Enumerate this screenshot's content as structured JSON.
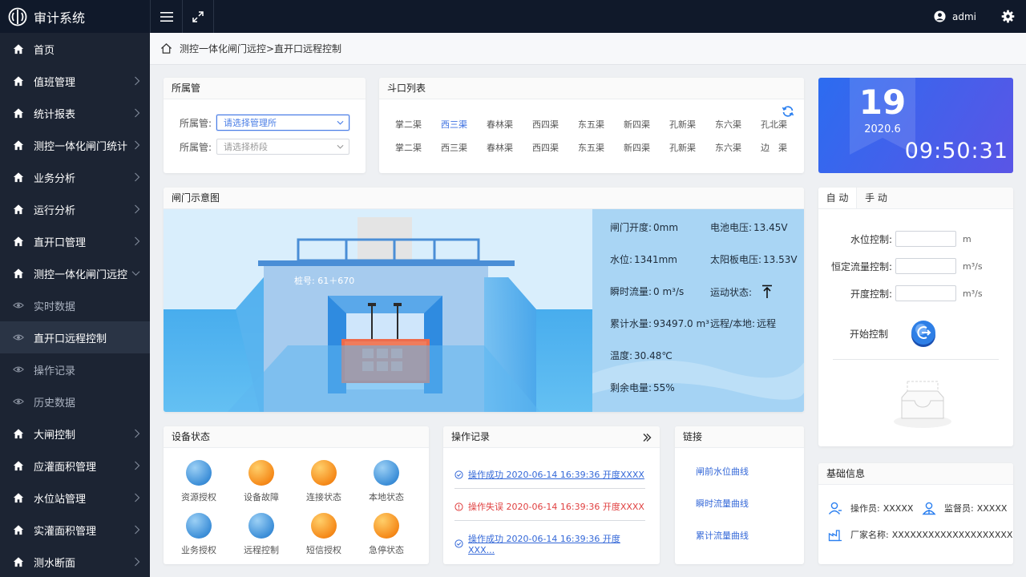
{
  "app": {
    "title": "审计系统",
    "user": "admi"
  },
  "sidebar": {
    "items": [
      {
        "label": "首页",
        "name": "home",
        "chevron": false
      },
      {
        "label": "值班管理",
        "name": "duty",
        "chevron": true
      },
      {
        "label": "统计报表",
        "name": "reports",
        "chevron": true
      },
      {
        "label": "测控一体化闸门统计",
        "name": "gate-stats",
        "chevron": true
      },
      {
        "label": "业务分析",
        "name": "business",
        "chevron": true
      },
      {
        "label": "运行分析",
        "name": "operation",
        "chevron": true
      },
      {
        "label": "直开口管理",
        "name": "outlet-mgmt",
        "chevron": true
      },
      {
        "label": "测控一体化闸门远控",
        "name": "gate-remote",
        "chevron": true,
        "open": true
      },
      {
        "label": "实时数据",
        "name": "realtime",
        "sub": true
      },
      {
        "label": "直开口远程控制",
        "name": "outlet-remote",
        "sub": true,
        "active": true
      },
      {
        "label": "操作记录",
        "name": "op-records",
        "sub": true
      },
      {
        "label": "历史数据",
        "name": "history",
        "sub": true
      },
      {
        "label": "大闸控制",
        "name": "big-gate",
        "chevron": true
      },
      {
        "label": "应灌面积管理",
        "name": "irrigation-area",
        "chevron": true
      },
      {
        "label": "水位站管理",
        "name": "water-station",
        "chevron": true
      },
      {
        "label": "实灌面积管理",
        "name": "actual-area",
        "chevron": true
      },
      {
        "label": "测水断面",
        "name": "section",
        "chevron": true
      }
    ]
  },
  "breadcrumb": "测控一体化闸门远控>直开口远程控制",
  "filter": {
    "title": "所属管",
    "row1_label": "所属管:",
    "row1_placeholder": "请选择管理所",
    "row2_label": "所属管:",
    "row2_placeholder": "请选择桥段"
  },
  "channels": {
    "title": "斗口列表",
    "items": [
      "掌二渠",
      "西三渠",
      "春林渠",
      "西四渠",
      "东五渠",
      "新四渠",
      "孔新渠",
      "东六渠",
      "孔北渠",
      "掌二渠",
      "西三渠",
      "春林渠",
      "西四渠",
      "东五渠",
      "新四渠",
      "孔新渠",
      "东六渠",
      "边　渠"
    ],
    "selected_index": 1
  },
  "date": {
    "day": "19",
    "year_month": "2020.6",
    "time": "09:50:31"
  },
  "gate": {
    "title": "闸门示意图",
    "stake": "桩号:  61＋670",
    "readings": {
      "opening_label": "闸门开度:",
      "opening": "0mm",
      "battery_label": "电池电压:",
      "battery": "13.45V",
      "level_label": "水位:",
      "level": "1341mm",
      "solar_label": "太阳板电压:",
      "solar": "13.53V",
      "flow_label": "瞬时流量:",
      "flow": "0 m³/s",
      "motion_label": "运动状态:",
      "total_label": "累计水量:",
      "total": "93497.0 m³",
      "mode_label": "远程/本地:",
      "mode": "远程",
      "temp_label": "温度:",
      "temp": "30.48℃",
      "power_label": "剩余电量:",
      "power": "55%"
    }
  },
  "control": {
    "tab_auto": "自 动",
    "tab_manual": "手 动",
    "level_label": "水位控制:",
    "level_unit": "m",
    "flow_label": "恒定流量控制:",
    "flow_unit": "m³/s",
    "open_label": "开度控制:",
    "open_unit": "m³/s",
    "start_label": "开始控制"
  },
  "devices": {
    "title": "设备状态",
    "items": [
      {
        "label": "资源授权",
        "color": "blue"
      },
      {
        "label": "设备故障",
        "color": "orange"
      },
      {
        "label": "连接状态",
        "color": "orange"
      },
      {
        "label": "本地状态",
        "color": "blue"
      },
      {
        "label": "业务授权",
        "color": "blue"
      },
      {
        "label": "远程控制",
        "color": "blue"
      },
      {
        "label": "短信授权",
        "color": "orange"
      },
      {
        "label": "急停状态",
        "color": "orange"
      }
    ]
  },
  "oplog": {
    "title": "操作记录",
    "items": [
      {
        "text": "操作成功 2020-06-14  16:39:36 开度XXXX",
        "status": "ok"
      },
      {
        "text": "操作失误 2020-06-14  16:39:36 开度XXXX",
        "status": "err"
      },
      {
        "text": "操作成功 2020-06-14  16:39:36 开度XXX...",
        "status": "ok"
      }
    ]
  },
  "links": {
    "title": "链接",
    "items": [
      "闸前水位曲线",
      "瞬时流量曲线",
      "累计流量曲线"
    ]
  },
  "basic": {
    "title": "基础信息",
    "operator_label": "操作员:",
    "operator": "XXXXX",
    "supervisor_label": "监督员:",
    "supervisor": "XXXXX",
    "vendor_label": "厂家名称:",
    "vendor": "XXXXXXXXXXXXXXXXXXXX"
  },
  "colors": {
    "accent": "#3b6fe0",
    "sidebar": "#1c2433",
    "topbar": "#10192a",
    "ok": "#3468d8",
    "err": "#e04040"
  }
}
